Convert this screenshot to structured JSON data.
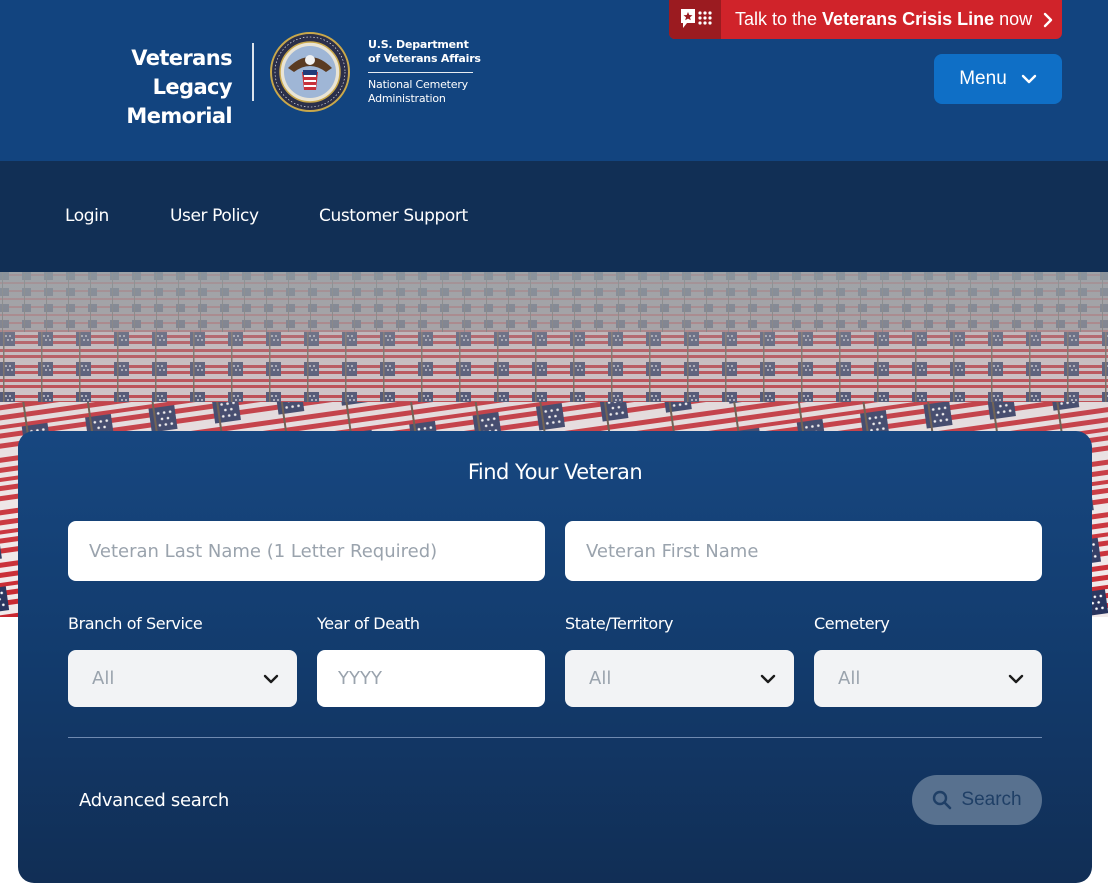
{
  "header": {
    "logo_line1": "Veterans Legacy",
    "logo_line2": "Memorial",
    "dept_line1a": "U.S. Department",
    "dept_line1b": "of Veterans Affairs",
    "dept_line2a": "National Cemetery",
    "dept_line2b": "Administration",
    "crisis_prefix": "Talk to the ",
    "crisis_bold": "Veterans Crisis Line",
    "crisis_suffix": " now",
    "menu_label": "Menu"
  },
  "nav": {
    "items": [
      {
        "label": "Login"
      },
      {
        "label": "User Policy"
      },
      {
        "label": "Customer Support"
      }
    ]
  },
  "search": {
    "title": "Find Your Veteran",
    "last_name_placeholder": "Veteran Last Name (1 Letter Required)",
    "first_name_placeholder": "Veteran First Name",
    "branch_label": "Branch of Service",
    "branch_value": "All",
    "year_label": "Year of Death",
    "year_placeholder": "YYYY",
    "state_label": "State/Territory",
    "state_value": "All",
    "cemetery_label": "Cemetery",
    "cemetery_value": "All",
    "advanced_label": "Advanced search",
    "search_button": "Search"
  },
  "colors": {
    "header_bg": "#12447f",
    "nav_bg": "#112f55",
    "crisis_red": "#d0232a",
    "menu_blue": "#0f6fc6",
    "panel_top": "#174780",
    "panel_bottom": "#112e55",
    "search_button_bg": "#58718f"
  },
  "icons": {
    "crisis": "chat-bubble-star-icon",
    "menu": "chevron-down-icon",
    "select": "chevron-down-icon",
    "search": "search-icon",
    "seal": "va-seal-icon"
  }
}
